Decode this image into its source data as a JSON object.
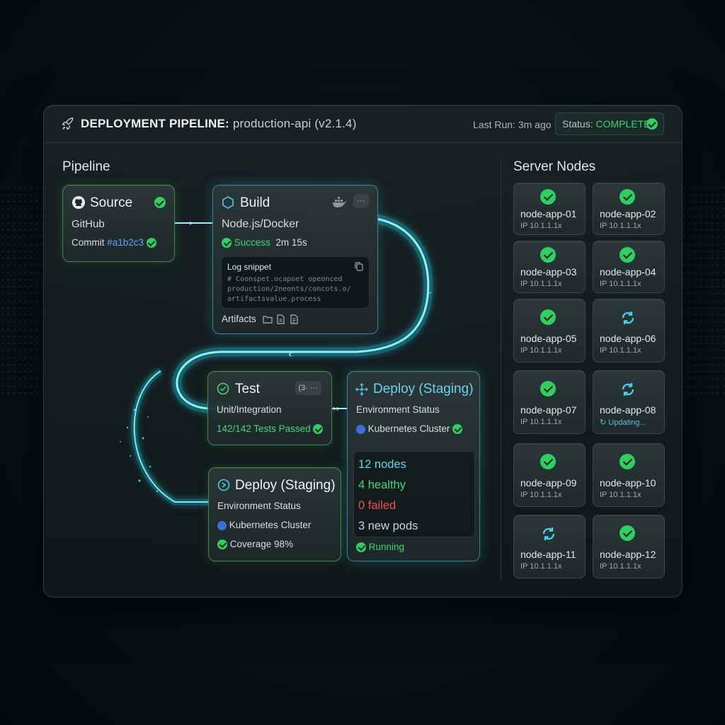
{
  "header": {
    "title_prefix": "DEPLOYMENT PIPELINE:",
    "title_suffix": "production-api (v2.1.4)",
    "last_run": "Last Run: 3m ago",
    "status_label": "Status:",
    "status_value": "COMPLETE"
  },
  "pipeline": {
    "title": "Pipeline",
    "source": {
      "title": "Source",
      "provider": "GitHub",
      "commit_label": "Commit",
      "commit_hash": "#a1b2c3"
    },
    "build": {
      "title": "Build",
      "stack": "Node.js/Docker",
      "status": "Success",
      "duration": "2m 15s",
      "log_title": "Log snippet",
      "log_lines": [
        "# Coonspet.ocapoet opeonced",
        "production/2neonts/concots.o/",
        "artifactsvalue.process"
      ],
      "artifacts_label": "Artifacts"
    },
    "test": {
      "title": "Test",
      "badge": "(3·",
      "kind": "Unit/Integration",
      "result": "142/142 Tests Passed"
    },
    "deploy_a": {
      "title": "Deploy (Staging)",
      "env_label": "Environment Status",
      "cluster": "Kubernetes Cluster",
      "nodes": "12 nodes",
      "healthy": "4 healthy",
      "failed": "0 failed",
      "pods": "3 new pods",
      "state": "Running"
    },
    "deploy_b": {
      "title": "Deploy (Staging)",
      "env_label": "Environment Status",
      "cluster": "Kubernetes Cluster",
      "coverage": "Coverage 98%"
    }
  },
  "servers": {
    "title": "Server Nodes",
    "nodes": [
      {
        "name": "node-app-01",
        "ip": "IP 10.1.1.1x",
        "state": "ok"
      },
      {
        "name": "node-app-02",
        "ip": "IP 10.1.1.1x",
        "state": "ok"
      },
      {
        "name": "node-app-03",
        "ip": "IP 10.1.1.1x",
        "state": "ok"
      },
      {
        "name": "node-app-04",
        "ip": "IP 10.1.1.1x",
        "state": "ok"
      },
      {
        "name": "node-app-05",
        "ip": "IP 10.1.1.1x",
        "state": "ok"
      },
      {
        "name": "node-app-06",
        "ip": "IP 10.1.1.1x",
        "state": "syncing"
      },
      {
        "name": "node-app-07",
        "ip": "IP 10.1.1.1x",
        "state": "ok"
      },
      {
        "name": "node-app-08",
        "ip": "Updating...",
        "state": "updating"
      },
      {
        "name": "node-app-09",
        "ip": "IP 10.1.1.1x",
        "state": "ok"
      },
      {
        "name": "node-app-10",
        "ip": "IP 10.1.1.1x",
        "state": "ok"
      },
      {
        "name": "node-app-11",
        "ip": "IP 10.1.1.1x",
        "state": "syncing"
      },
      {
        "name": "node-app-12",
        "ip": "IP 10.1.1.1x",
        "state": "ok"
      }
    ]
  },
  "colors": {
    "success": "#2fcf60",
    "accent": "#2ee6f0",
    "failed": "#ef5350"
  }
}
